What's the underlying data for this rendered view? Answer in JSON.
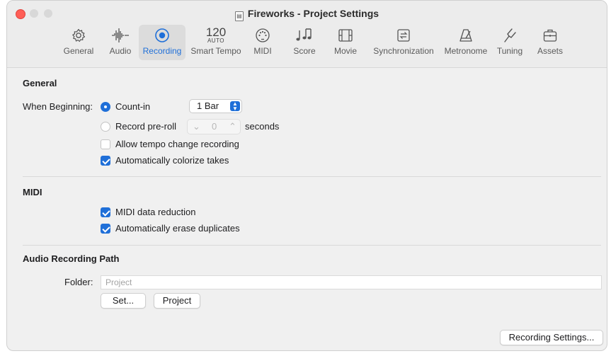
{
  "window": {
    "title": "Fireworks - Project Settings"
  },
  "toolbar": {
    "items": [
      {
        "label": "General",
        "icon": "gear-icon",
        "active": false
      },
      {
        "label": "Audio",
        "icon": "waveform-icon",
        "active": false
      },
      {
        "label": "Recording",
        "icon": "record-icon",
        "active": true
      },
      {
        "label": "Smart Tempo",
        "icon": "tempo-icon",
        "active": false,
        "tempo_value": "120",
        "tempo_mode": "AUTO"
      },
      {
        "label": "MIDI",
        "icon": "midi-port-icon",
        "active": false
      },
      {
        "label": "Score",
        "icon": "notes-icon",
        "active": false
      },
      {
        "label": "Movie",
        "icon": "film-icon",
        "active": false
      },
      {
        "label": "Synchronization",
        "icon": "sync-icon",
        "active": false
      },
      {
        "label": "Metronome",
        "icon": "metronome-icon",
        "active": false
      },
      {
        "label": "Tuning",
        "icon": "tuning-fork-icon",
        "active": false
      },
      {
        "label": "Assets",
        "icon": "briefcase-icon",
        "active": false
      }
    ]
  },
  "general": {
    "title": "General",
    "when_beginning_label": "When Beginning:",
    "count_in_label": "Count-in",
    "count_in_selected": true,
    "count_in_value": "1 Bar",
    "preroll_label": "Record pre-roll",
    "preroll_selected": false,
    "preroll_value": "0",
    "preroll_unit": "seconds",
    "allow_tempo_label": "Allow tempo change recording",
    "allow_tempo_checked": false,
    "colorize_label": "Automatically colorize takes",
    "colorize_checked": true
  },
  "midi": {
    "title": "MIDI",
    "data_reduction_label": "MIDI data reduction",
    "data_reduction_checked": true,
    "erase_duplicates_label": "Automatically erase duplicates",
    "erase_duplicates_checked": true
  },
  "audio_path": {
    "title": "Audio Recording Path",
    "folder_label": "Folder:",
    "folder_placeholder": "Project",
    "set_button": "Set...",
    "project_button": "Project"
  },
  "footer": {
    "recording_settings_button": "Recording Settings..."
  },
  "colors": {
    "accent": "#1f6fd8",
    "close": "#ff5f57"
  }
}
